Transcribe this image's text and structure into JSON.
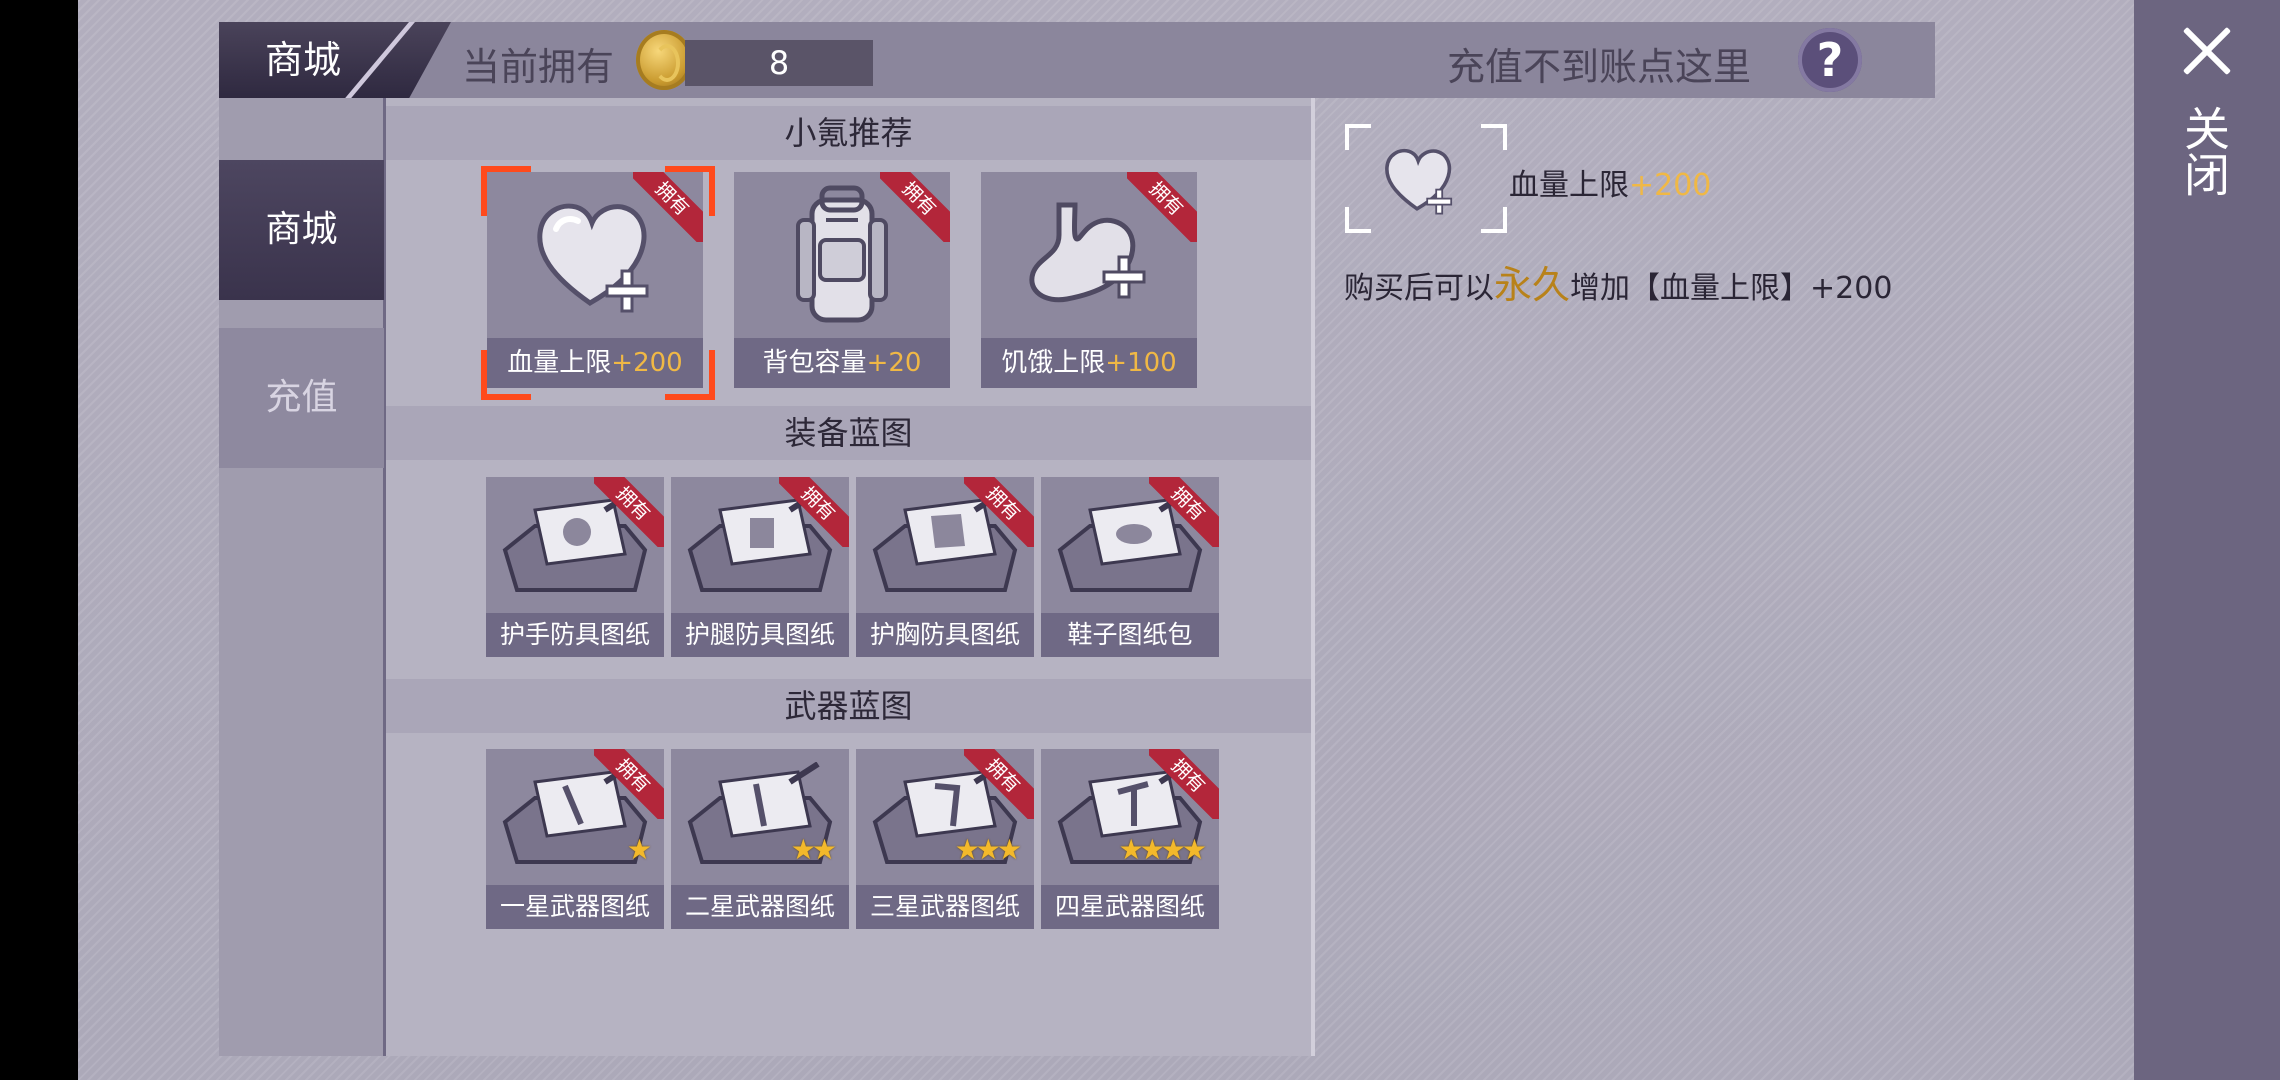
{
  "close": {
    "label": "关闭"
  },
  "header": {
    "tab_label": "商城",
    "owned_label": "当前拥有",
    "coin_count": "8",
    "recharge_help_text": "充值不到账点这里",
    "help_symbol": "?"
  },
  "sidebar": {
    "items": [
      {
        "label": "商城",
        "active": true
      },
      {
        "label": "充值",
        "active": false
      }
    ]
  },
  "sections": {
    "recommend": {
      "title": "小氪推荐",
      "items": [
        {
          "name": "血量上限",
          "bonus": "+200",
          "ribbon": "拥有",
          "icon": "heart-plus-icon",
          "selected": true
        },
        {
          "name": "背包容量",
          "bonus": "+20",
          "ribbon": "拥有",
          "icon": "backpack-icon",
          "selected": false
        },
        {
          "name": "饥饿上限",
          "bonus": "+100",
          "ribbon": "拥有",
          "icon": "stomach-plus-icon",
          "selected": false
        }
      ]
    },
    "equipment": {
      "title": "装备蓝图",
      "items": [
        {
          "name": "护手防具图纸",
          "ribbon": "拥有",
          "icon": "gloves-blueprint-icon"
        },
        {
          "name": "护腿防具图纸",
          "ribbon": "拥有",
          "icon": "pants-blueprint-icon"
        },
        {
          "name": "护胸防具图纸",
          "ribbon": "拥有",
          "icon": "chest-blueprint-icon"
        },
        {
          "name": "鞋子图纸包",
          "ribbon": "拥有",
          "icon": "shoes-blueprint-icon"
        }
      ]
    },
    "weapons": {
      "title": "武器蓝图",
      "items": [
        {
          "name": "一星武器图纸",
          "ribbon": "拥有",
          "stars": "★",
          "icon": "weapon-blueprint-icon"
        },
        {
          "name": "二星武器图纸",
          "ribbon": "",
          "stars": "★★",
          "icon": "weapon-blueprint-icon"
        },
        {
          "name": "三星武器图纸",
          "ribbon": "拥有",
          "stars": "★★★",
          "icon": "weapon-blueprint-icon"
        },
        {
          "name": "四星武器图纸",
          "ribbon": "拥有",
          "stars": "★★★★",
          "icon": "weapon-blueprint-icon"
        }
      ]
    }
  },
  "detail": {
    "name": "血量上限",
    "bonus": "+200",
    "desc_prefix": "购买后可以",
    "desc_highlight": "永久",
    "desc_suffix": "增加【血量上限】+200"
  },
  "colors": {
    "bonus": "#f0b845",
    "ribbon": "#b3263a",
    "selection": "#ff4a1c",
    "permanent": "#b8821a"
  }
}
